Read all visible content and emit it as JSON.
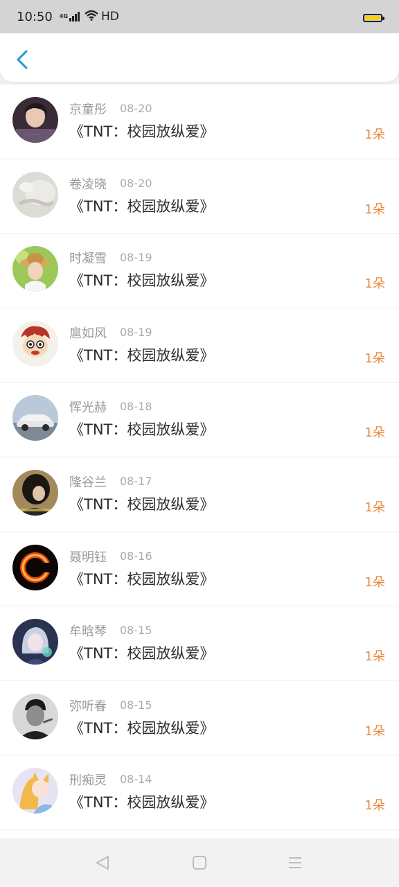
{
  "status": {
    "time": "10:50",
    "network": "4G",
    "hd": "HD"
  },
  "header": {
    "back_icon": "chevron-left-icon"
  },
  "colors": {
    "accent": "#2196d6",
    "amount": "#e98a3e",
    "battery": "#f7cf1d"
  },
  "items": [
    {
      "name": "京童彤",
      "date": "08-20",
      "title": "《TNT：校园放纵爱》",
      "amount": "1朵",
      "avatar": "avatar-young-man"
    },
    {
      "name": "卷凌晓",
      "date": "08-20",
      "title": "《TNT：校园放纵爱》",
      "amount": "1朵",
      "avatar": "avatar-pale-hand"
    },
    {
      "name": "时凝雪",
      "date": "08-19",
      "title": "《TNT：校园放纵爱》",
      "amount": "1朵",
      "avatar": "avatar-girl-hat"
    },
    {
      "name": "扈如风",
      "date": "08-19",
      "title": "《TNT：校园放纵爱》",
      "amount": "1朵",
      "avatar": "avatar-cartoon"
    },
    {
      "name": "恽光赫",
      "date": "08-18",
      "title": "《TNT：校园放纵爱》",
      "amount": "1朵",
      "avatar": "avatar-car"
    },
    {
      "name": "隆谷兰",
      "date": "08-17",
      "title": "《TNT：校园放纵爱》",
      "amount": "1朵",
      "avatar": "avatar-dark-woman"
    },
    {
      "name": "聂明钰",
      "date": "08-16",
      "title": "《TNT：校园放纵爱》",
      "amount": "1朵",
      "avatar": "avatar-fire-letter"
    },
    {
      "name": "牟晗琴",
      "date": "08-15",
      "title": "《TNT：校园放纵爱》",
      "amount": "1朵",
      "avatar": "avatar-anime-girl"
    },
    {
      "name": "弥听春",
      "date": "08-15",
      "title": "《TNT：校园放纵爱》",
      "amount": "1朵",
      "avatar": "avatar-man-bw"
    },
    {
      "name": "刑痴灵",
      "date": "08-14",
      "title": "《TNT：校园放纵爱》",
      "amount": "1朵",
      "avatar": "avatar-anime-fox"
    }
  ]
}
